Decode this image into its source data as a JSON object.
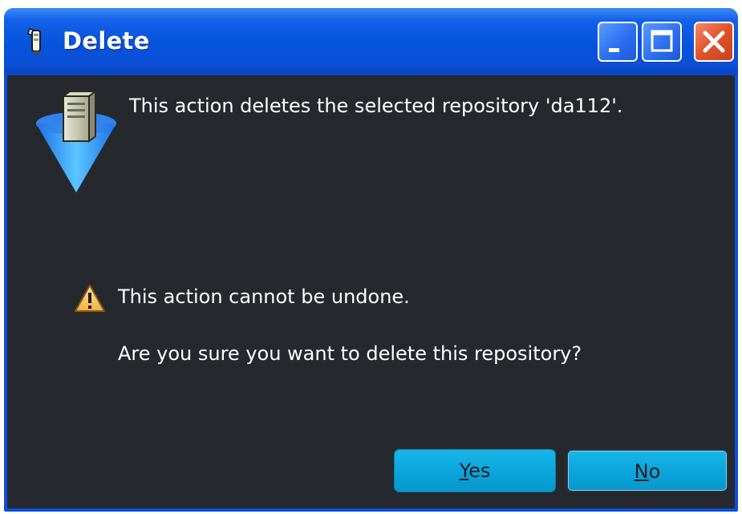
{
  "window": {
    "title": "Delete",
    "controls": {
      "minimize": "minimize-icon",
      "maximize": "maximize-icon",
      "close": "close-icon"
    }
  },
  "dialog": {
    "description": "This action deletes the selected repository 'da112'.",
    "warning": "This action cannot be undone.",
    "question": "Are you sure you want to delete this repository?"
  },
  "buttons": {
    "yes_mnemonic": "Y",
    "yes_rest": "es",
    "no_mnemonic": "N",
    "no_rest": "o"
  },
  "colors": {
    "titlebar": "#0653dc",
    "client_background": "#25292e",
    "button": "#0aa6dc",
    "close_button": "#e0532a"
  }
}
